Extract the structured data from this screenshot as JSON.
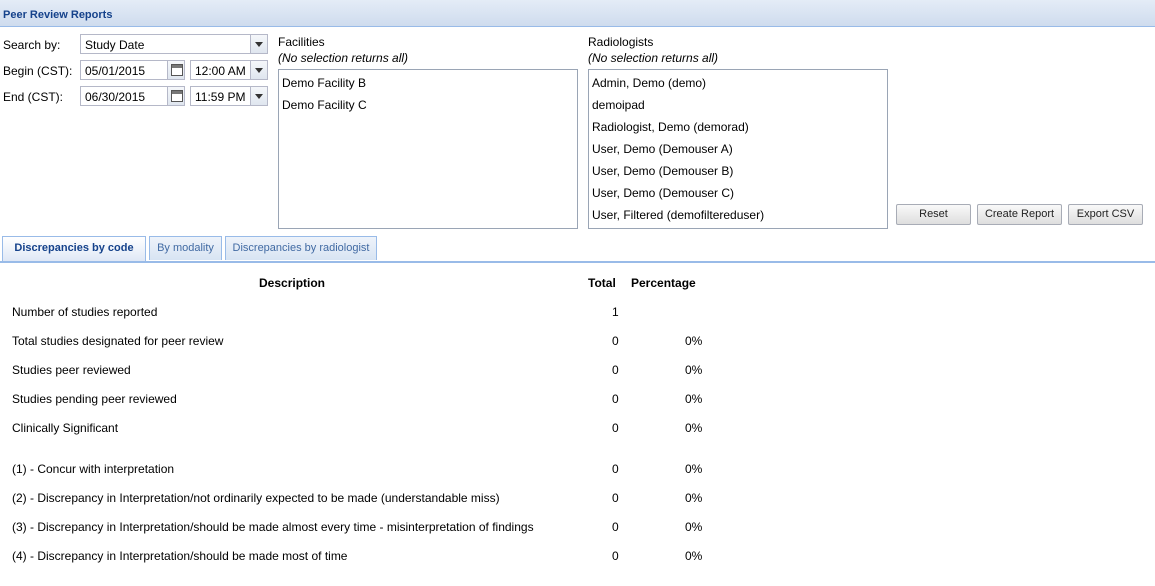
{
  "title": "Peer Review Reports",
  "search": {
    "label": "Search by:",
    "value": "Study Date"
  },
  "begin": {
    "label": "Begin (CST):",
    "date": "05/01/2015",
    "time": "12:00 AM"
  },
  "end": {
    "label": "End (CST):",
    "date": "06/30/2015",
    "time": "11:59 PM"
  },
  "facilities": {
    "label": "Facilities",
    "hint": "(No selection returns all)",
    "items": [
      "Demo Facility B",
      "Demo Facility C"
    ]
  },
  "radiologists": {
    "label": "Radiologists",
    "hint": "(No selection returns all)",
    "items": [
      "Admin, Demo (demo)",
      "demoipad",
      "Radiologist, Demo (demorad)",
      "User, Demo (Demouser A)",
      "User, Demo (Demouser B)",
      "User, Demo (Demouser C)",
      "User, Filtered (demofiltereduser)"
    ]
  },
  "buttons": {
    "reset": "Reset",
    "create": "Create Report",
    "export": "Export CSV"
  },
  "tabs": [
    "Discrepancies by code",
    "By modality",
    "Discrepancies by radiologist"
  ],
  "table": {
    "headers": {
      "description": "Description",
      "total": "Total",
      "percentage": "Percentage"
    },
    "rows": [
      {
        "description": "Number of studies reported",
        "total": "1",
        "percentage": ""
      },
      {
        "description": "Total studies designated for peer review",
        "total": "0",
        "percentage": "0%"
      },
      {
        "description": "Studies peer reviewed",
        "total": "0",
        "percentage": "0%"
      },
      {
        "description": "Studies pending peer reviewed",
        "total": "0",
        "percentage": "0%"
      },
      {
        "description": "Clinically Significant",
        "total": "0",
        "percentage": "0%"
      },
      {
        "description": "(1) - Concur with interpretation",
        "total": "0",
        "percentage": "0%"
      },
      {
        "description": "(2) - Discrepancy in Interpretation/not ordinarily expected to be made (understandable miss)",
        "total": "0",
        "percentage": "0%"
      },
      {
        "description": "(3) - Discrepancy in Interpretation/should be made almost every time - misinterpretation of findings",
        "total": "0",
        "percentage": "0%"
      },
      {
        "description": "(4) - Discrepancy in Interpretation/should be made most of time",
        "total": "0",
        "percentage": "0%"
      }
    ]
  }
}
